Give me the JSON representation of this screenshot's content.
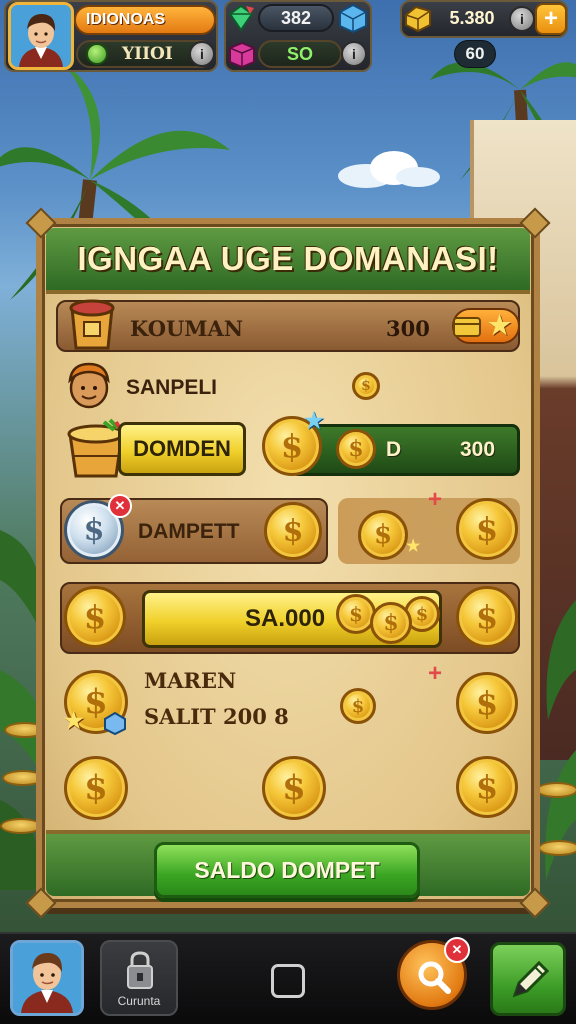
{
  "hud": {
    "player_name": "IDIONOAS",
    "player_sub": "YIIOI",
    "gems": "382",
    "potions": "SO",
    "coins": "5.380",
    "coins_sub": "60",
    "plus_label": "+"
  },
  "panel": {
    "title": "IGNGAA UGE DOMANASI!",
    "row1": {
      "label": "KOUMAN",
      "value": "300"
    },
    "row2": {
      "label": "SANPELI"
    },
    "row3": {
      "button": "DOMDEN",
      "letter": "D",
      "value": "300"
    },
    "row4": {
      "label": "DAMPETT"
    },
    "row5": {
      "bar_label": "SA.000"
    },
    "row6": {
      "label_top": "MAREN",
      "label_bottom": "SALIT 200 8"
    },
    "action_button": "SALDO DOMPET"
  },
  "bottom": {
    "tab_label": "Curunta"
  },
  "symbols": {
    "coin": "$",
    "star": "★",
    "cross": "✕",
    "plus": "+",
    "info": "i"
  },
  "colors": {
    "accent_orange": "#e37a12",
    "accent_green": "#3aa523",
    "panel": "#e3c68a",
    "coin_gold": "#f6c83a"
  }
}
